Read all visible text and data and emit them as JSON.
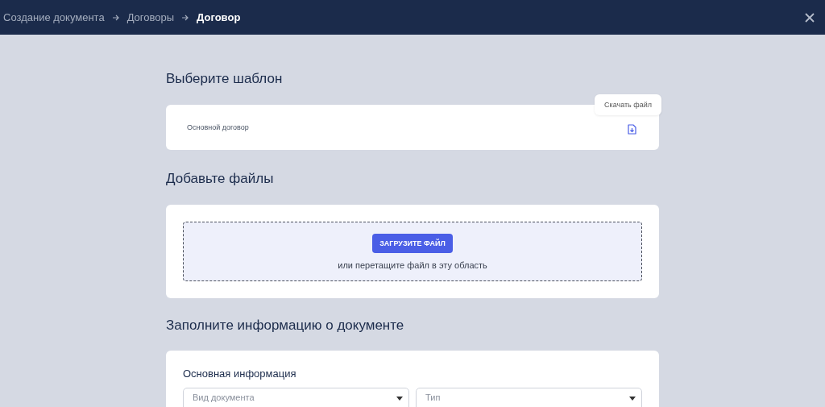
{
  "breadcrumbs": [
    {
      "label": "Создание документа",
      "selected": false
    },
    {
      "label": "Договоры",
      "selected": false
    },
    {
      "label": "Договор",
      "selected": true
    }
  ],
  "template_section": {
    "title": "Выберите шаблон",
    "template": "Основной договор",
    "tooltip": "Скачать файл"
  },
  "files_section": {
    "title": "Добавьте файлы",
    "upload_button": "ЗАГРУЗИТЕ ФАЙЛ",
    "hint": "или перетащите файл в эту область"
  },
  "info_section": {
    "title": "Заполните информацию о документе",
    "subtitle": "Основная информация",
    "fields": [
      {
        "placeholder": "Вид документа"
      },
      {
        "placeholder": "Тип"
      }
    ]
  }
}
